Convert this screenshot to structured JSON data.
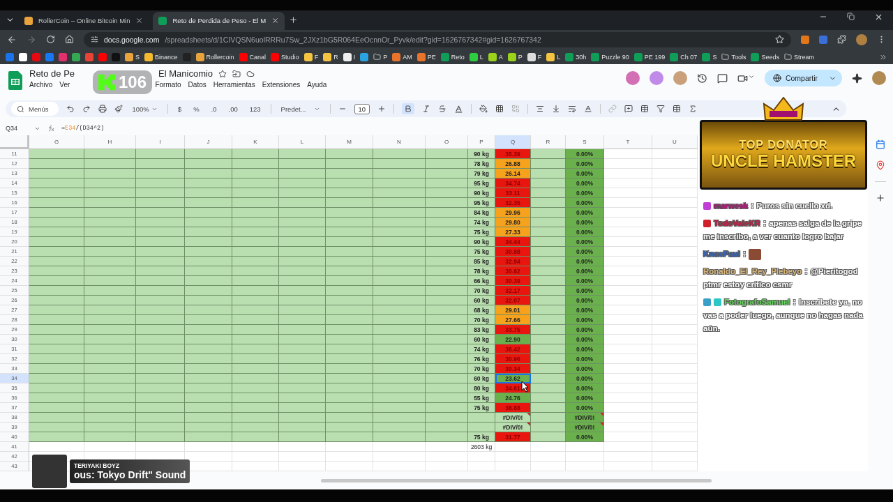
{
  "browser": {
    "tabs": [
      {
        "title": "RollerCoin – Online Bitcoin Min",
        "selected": false
      },
      {
        "title": "Reto de Perdida de Peso - El M",
        "selected": true
      }
    ],
    "url_host": "docs.google.com",
    "url_path": "/spreadsheets/d/1CIVQSN6uolRRRu7Sw_2JXz1bG5R064EeOcnnOr_Pyvk/edit?gid=1626767342#gid=1626767342",
    "bookmarks": [
      {
        "kind": "site",
        "color": "#1a73e8"
      },
      {
        "kind": "site",
        "color": "#ffffff"
      },
      {
        "kind": "site",
        "color": "#e50914"
      },
      {
        "kind": "site",
        "color": "#1877f2"
      },
      {
        "kind": "site",
        "color": "#e1306c"
      },
      {
        "kind": "site",
        "color": "#34a853"
      },
      {
        "kind": "site",
        "color": "#ea4335"
      },
      {
        "kind": "site",
        "color": "#ff0000"
      },
      {
        "kind": "site",
        "color": "#111111"
      },
      {
        "kind": "site",
        "color": "#e8a33c",
        "label": "S"
      },
      {
        "kind": "site",
        "color": "#f3ba2f",
        "label": "Binance"
      },
      {
        "kind": "site",
        "color": "#222222"
      },
      {
        "kind": "site",
        "color": "#e8a33c",
        "label": "Rollercoin"
      },
      {
        "kind": "site",
        "color": "#ff0000",
        "label": "Canal"
      },
      {
        "kind": "site",
        "color": "#ff0000",
        "label": "Studio"
      },
      {
        "kind": "site",
        "color": "#f5c542",
        "label": "F"
      },
      {
        "kind": "site",
        "color": "#f5c542",
        "label": "R"
      },
      {
        "kind": "site",
        "color": "#eeeeee",
        "label": "I"
      },
      {
        "kind": "site",
        "color": "#2aa3e0"
      },
      {
        "kind": "folder",
        "label": "P"
      },
      {
        "kind": "site",
        "color": "#e8742c",
        "label": "AM"
      },
      {
        "kind": "site",
        "color": "#e8742c",
        "label": "PE"
      },
      {
        "kind": "sheet",
        "label": "Reto"
      },
      {
        "kind": "site",
        "color": "#2ecc40",
        "label": "L"
      },
      {
        "kind": "site",
        "color": "#9bd21c",
        "label": "A"
      },
      {
        "kind": "site",
        "color": "#9bd21c",
        "label": "P"
      },
      {
        "kind": "site",
        "color": "#dddddd",
        "label": "F"
      },
      {
        "kind": "site",
        "color": "#f5c542",
        "label": "L"
      },
      {
        "kind": "sheet",
        "label": "30h"
      },
      {
        "kind": "sheet",
        "label": "Puzzle 90"
      },
      {
        "kind": "sheet",
        "label": "PE 199"
      },
      {
        "kind": "sheet",
        "label": "Ch 07"
      },
      {
        "kind": "sheet",
        "label": "S"
      },
      {
        "kind": "folder",
        "label": "Tools"
      },
      {
        "kind": "sheet",
        "label": "Seeds"
      },
      {
        "kind": "folder",
        "label": "Stream"
      }
    ]
  },
  "sheet": {
    "title_parts": [
      "Reto de Pe",
      "El Manicomio"
    ],
    "menus": [
      "Archivo",
      "Ver",
      "Formato",
      "Datos",
      "Herramientas",
      "Extensiones",
      "Ayuda"
    ],
    "collaborators": [
      {
        "color": "#d36fb4"
      },
      {
        "color": "#c08ae8"
      },
      {
        "color": "#c9a07a"
      }
    ],
    "share_label": "Compartir",
    "toolbar": {
      "search": "Menús",
      "zoom": "100%",
      "currency": "$",
      "percent": "%",
      "dec_less": ".0",
      "dec_more": ".00",
      "format_more": "123",
      "font": "Predet...",
      "font_size": "10",
      "bold_on": true
    },
    "cell_ref": "Q34",
    "formula_parts": [
      {
        "text": "=",
        "kind": "plain"
      },
      {
        "text": "E34",
        "kind": "ref"
      },
      {
        "text": "/(D34^2)",
        "kind": "plain"
      }
    ],
    "columns": [
      {
        "label": "G",
        "selected": false
      },
      {
        "label": "H",
        "selected": false
      },
      {
        "label": "I",
        "selected": false
      },
      {
        "label": "J",
        "selected": false
      },
      {
        "label": "K",
        "selected": false
      },
      {
        "label": "L",
        "selected": false
      },
      {
        "label": "M",
        "selected": false
      },
      {
        "label": "N",
        "selected": false
      },
      {
        "label": "O",
        "selected": false
      },
      {
        "label": "P",
        "selected": false
      },
      {
        "label": "Q",
        "selected": true
      },
      {
        "label": "R",
        "selected": false
      },
      {
        "label": "S",
        "selected": false
      },
      {
        "label": "T",
        "selected": false
      },
      {
        "label": "U",
        "selected": false
      }
    ],
    "rows": [
      {
        "number": "11",
        "kind": "data",
        "p": "90 kg",
        "q": "35.39",
        "color": "#e8160f",
        "s": "0.00%",
        "error": false,
        "selected": false
      },
      {
        "number": "12",
        "kind": "data",
        "p": "78 kg",
        "q": "26.88",
        "color": "#f6a21d",
        "s": "0.00%",
        "error": false,
        "selected": false
      },
      {
        "number": "13",
        "kind": "data",
        "p": "79 kg",
        "q": "26.14",
        "color": "#f6a21d",
        "s": "0.00%",
        "error": false,
        "selected": false
      },
      {
        "number": "14",
        "kind": "data",
        "p": "95 kg",
        "q": "34.74",
        "color": "#e8160f",
        "s": "0.00%",
        "error": false,
        "selected": false
      },
      {
        "number": "15",
        "kind": "data",
        "p": "90 kg",
        "q": "33.11",
        "color": "#e8160f",
        "s": "0.00%",
        "error": false,
        "selected": false
      },
      {
        "number": "16",
        "kind": "data",
        "p": "95 kg",
        "q": "32.35",
        "color": "#e8160f",
        "s": "0.00%",
        "error": false,
        "selected": false
      },
      {
        "number": "17",
        "kind": "data",
        "p": "84 kg",
        "q": "29.96",
        "color": "#f6a21d",
        "s": "0.00%",
        "error": false,
        "selected": false
      },
      {
        "number": "18",
        "kind": "data",
        "p": "74 kg",
        "q": "29.80",
        "color": "#f6a21d",
        "s": "0.00%",
        "error": false,
        "selected": false
      },
      {
        "number": "19",
        "kind": "data",
        "p": "75 kg",
        "q": "27.33",
        "color": "#f6a21d",
        "s": "0.00%",
        "error": false,
        "selected": false
      },
      {
        "number": "20",
        "kind": "data",
        "p": "90 kg",
        "q": "34.44",
        "color": "#e8160f",
        "s": "0.00%",
        "error": false,
        "selected": false
      },
      {
        "number": "21",
        "kind": "data",
        "p": "75 kg",
        "q": "30.98",
        "color": "#e8160f",
        "s": "0.00%",
        "error": false,
        "selected": false
      },
      {
        "number": "22",
        "kind": "data",
        "p": "85 kg",
        "q": "32.94",
        "color": "#e8160f",
        "s": "0.00%",
        "error": false,
        "selected": false
      },
      {
        "number": "23",
        "kind": "data",
        "p": "78 kg",
        "q": "30.62",
        "color": "#e8160f",
        "s": "0.00%",
        "error": false,
        "selected": false
      },
      {
        "number": "24",
        "kind": "data",
        "p": "66 kg",
        "q": "30.39",
        "color": "#e8160f",
        "s": "0.00%",
        "error": false,
        "selected": false
      },
      {
        "number": "25",
        "kind": "data",
        "p": "70 kg",
        "q": "32.17",
        "color": "#e8160f",
        "s": "0.00%",
        "error": false,
        "selected": false
      },
      {
        "number": "26",
        "kind": "data",
        "p": "60 kg",
        "q": "32.07",
        "color": "#e8160f",
        "s": "0.00%",
        "error": false,
        "selected": false
      },
      {
        "number": "27",
        "kind": "data",
        "p": "68 kg",
        "q": "29.01",
        "color": "#f6a21d",
        "s": "0.00%",
        "error": false,
        "selected": false
      },
      {
        "number": "28",
        "kind": "data",
        "p": "70 kg",
        "q": "27.66",
        "color": "#f6a21d",
        "s": "0.00%",
        "error": false,
        "selected": false
      },
      {
        "number": "29",
        "kind": "data",
        "p": "83 kg",
        "q": "33.75",
        "color": "#e8160f",
        "s": "0.00%",
        "error": false,
        "selected": false
      },
      {
        "number": "30",
        "kind": "data",
        "p": "60 kg",
        "q": "22.90",
        "color": "#6ab04c",
        "s": "0.00%",
        "error": false,
        "selected": false
      },
      {
        "number": "31",
        "kind": "data",
        "p": "74 kg",
        "q": "36.42",
        "color": "#e8160f",
        "s": "0.00%",
        "error": false,
        "selected": false
      },
      {
        "number": "32",
        "kind": "data",
        "p": "76 kg",
        "q": "30.96",
        "color": "#e8160f",
        "s": "0.00%",
        "error": false,
        "selected": false
      },
      {
        "number": "33",
        "kind": "data",
        "p": "70 kg",
        "q": "30.34",
        "color": "#e8160f",
        "s": "0.00%",
        "error": false,
        "selected": false
      },
      {
        "number": "34",
        "kind": "data",
        "p": "60 kg",
        "q": "23.62",
        "color": "#6ab04c",
        "s": "0.00%",
        "error": false,
        "selected": true
      },
      {
        "number": "35",
        "kind": "data",
        "p": "80 kg",
        "q": "34.61",
        "color": "#e8160f",
        "s": "0.00%",
        "error": false,
        "selected": false
      },
      {
        "number": "36",
        "kind": "data",
        "p": "55 kg",
        "q": "24.76",
        "color": "#6ab04c",
        "s": "0.00%",
        "error": false,
        "selected": false
      },
      {
        "number": "37",
        "kind": "data",
        "p": "75 kg",
        "q": "38.88",
        "color": "#e8160f",
        "s": "0.00%",
        "error": false,
        "selected": false
      },
      {
        "number": "38",
        "kind": "data",
        "q": "#DIV/0!",
        "color": "#b9deb0",
        "s": "#DIV/0!",
        "error": true,
        "selected": false
      },
      {
        "number": "39",
        "kind": "data",
        "q": "#DIV/0!",
        "color": "#b9deb0",
        "s": "#DIV/0!",
        "error": true,
        "selected": false
      },
      {
        "number": "40",
        "kind": "data",
        "p": "75 kg",
        "q": "31.77",
        "color": "#e8160f",
        "s": "0.00%",
        "error": false,
        "selected": false
      },
      {
        "number": "41",
        "kind": "total",
        "p": "2603 kg",
        "selected": false
      },
      {
        "number": "42",
        "kind": "empty",
        "selected": false
      },
      {
        "number": "43",
        "kind": "empty",
        "selected": false
      }
    ]
  },
  "stream": {
    "viewer_count": "106",
    "banner": {
      "heading": "TOP DONATOR",
      "name": "UNCLE HAMSTER"
    },
    "chat": [
      {
        "user": "marwesk",
        "color": "#b3157a",
        "badges": [
          {
            "color": "#c23fd6"
          }
        ],
        "kind": "text",
        "separator": ":",
        "text": "Puros sin cuello xd."
      },
      {
        "user": "TodoValeKR",
        "color": "#c21f45",
        "badges": [
          {
            "color": "#d0202c"
          }
        ],
        "kind": "text",
        "separator": ":",
        "text": "apenas salga de la gripe me inscribo, a ver cuanto logro bajar"
      },
      {
        "user": "KnoxPaul",
        "color": "#3a66b8",
        "kind": "emote",
        "separator": ":"
      },
      {
        "user": "Ronaldo_El_Rey_Plebeyo",
        "color": "#d9b77a",
        "kind": "text",
        "separator": ":",
        "text": "@Pieritogod ptmr estoy crítico csmr"
      },
      {
        "user": "FotografoSamuel",
        "color": "#63d65a",
        "badges": [
          {
            "color": "#3ba0c8"
          },
          {
            "color": "#2bc6c6"
          }
        ],
        "kind": "text",
        "separator": ":",
        "text": "Inscribete ya, no vas a poder luego, aunque no hagas nada aún."
      }
    ],
    "now_playing": {
      "artist": "TERIYAKI BOYZ",
      "track": "ous: Tokyo Drift\" Sound"
    }
  }
}
